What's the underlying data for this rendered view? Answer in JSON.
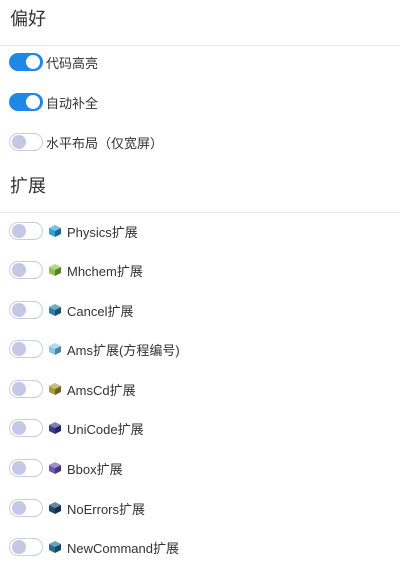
{
  "preferences": {
    "title": "偏好",
    "items": [
      {
        "label": "代码高亮",
        "enabled": true
      },
      {
        "label": "自动补全",
        "enabled": true
      },
      {
        "label": "水平布局（仅宽屏）",
        "enabled": false
      }
    ]
  },
  "extensions": {
    "title": "扩展",
    "items": [
      {
        "label": "Physics扩展",
        "enabled": false,
        "icon": "cube-icon",
        "color": "#2f9fd6"
      },
      {
        "label": "Mhchem扩展",
        "enabled": false,
        "icon": "cube-icon",
        "color": "#8bc34a"
      },
      {
        "label": "Cancel扩展",
        "enabled": false,
        "icon": "cube-icon",
        "color": "#2a7fa8"
      },
      {
        "label": "Ams扩展(方程编号)",
        "enabled": false,
        "icon": "cube-icon",
        "color": "#7fc8f0"
      },
      {
        "label": "AmsCd扩展",
        "enabled": false,
        "icon": "cube-icon",
        "color": "#a89a3a"
      },
      {
        "label": "UniCode扩展",
        "enabled": false,
        "icon": "cube-icon",
        "color": "#3b3a8f"
      },
      {
        "label": "Bbox扩展",
        "enabled": false,
        "icon": "cube-icon",
        "color": "#6a5ab0"
      },
      {
        "label": "NoErrors扩展",
        "enabled": false,
        "icon": "cube-icon",
        "color": "#1f4a6e"
      },
      {
        "label": "NewCommand扩展",
        "enabled": false,
        "icon": "cube-icon",
        "color": "#1f6e94"
      }
    ]
  }
}
